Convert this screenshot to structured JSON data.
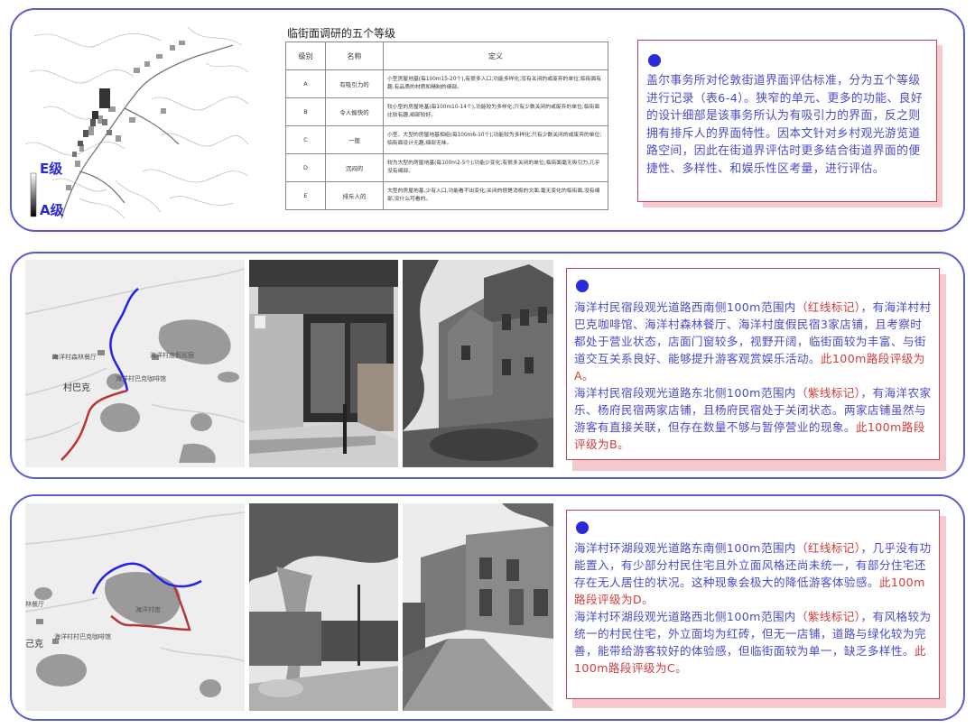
{
  "section1": {
    "map": {
      "legend_top": "E级",
      "legend_bottom": "A级"
    },
    "table": {
      "title": "临街面调研的五个等级",
      "headers": [
        "级别",
        "名称",
        "定义"
      ],
      "rows": [
        {
          "level": "A",
          "name": "有吸引力的",
          "def": "小型房屋地基(每100m15-20个),有很多入口;功能多样化;没有关闭的或废弃的单位;临街面有趣,有品质的材质和精制的细部。"
        },
        {
          "level": "B",
          "name": "令人愉快的",
          "def": "较小型的房屋地基(每100m10-14个),功能较为多样化;只有少数关闭的或废弃的单位;临街面比较有趣,细部较好。"
        },
        {
          "level": "C",
          "name": "一般",
          "def": "小型、大型的房屋地基相组(每100m6-10个);功能较为多样化;只有少数关闭的或废弃的单位;临街面设计无趣,细部无味。"
        },
        {
          "level": "D",
          "name": "沉闷的",
          "def": "较为大型的房屋地基(每100m2-5个);功能少变化;有很多关闭的单位;临街面毫无吸引力,几乎没有细部。"
        },
        {
          "level": "E",
          "name": "排斥人的",
          "def": "大型的房屋地基,少有入口,功能看不出变化;关闭的很是消极的文面,毫无变化的临街面,没有细部,没什么可看的。"
        }
      ]
    },
    "card": {
      "text": "盖尔事务所对伦敦街道界面评估标准，分为五个等级进行记录（表6-4）。狭窄的单元、更多的功能、良好的设计细部是该事务所认为有吸引力的界面，反之则拥有排斥人的界面特性。因本文针对乡村观光游览道路空间，因此在街道界评估时更多结合街道界面的便捷性、多样性、和娱乐性区考量，进行评估。"
    }
  },
  "section2": {
    "map": {
      "label_restaurant": "海洋村森林餐厅",
      "label_cafe": "海洋村巴克咖啡馆",
      "label_hotel": "海洋村度假民宿",
      "label_village": "村巴克"
    },
    "card": {
      "p1_a": "海洋村民宿段观光道路西南侧100m范围内",
      "p1_mark": "（红线标记）",
      "p1_b": "，有海洋村村巴克咖啡馆、海洋村森林餐厅、海洋村度假民宿3家店铺，且考察时都处于营业状态，店面门窗较多，视野开阔，临街面较为丰富、与街道交互关系良好、能够提升游客观赏娱乐活动。",
      "p1_grade": "此100m路段评级为A。",
      "p2_a": "海洋村民宿段观光道路东北侧100m范围内",
      "p2_mark": "（紫线标记）",
      "p2_b": "，有海洋农家乐、杨府民宿两家店铺，且杨府民宿处于关闭状态。两家店铺虽然与游客有直接关联，但存在数量不够与暂停营业的现象。",
      "p2_grade": "此100m路段评级为B。"
    }
  },
  "section3": {
    "map": {
      "label_restaurant": "林餐厅",
      "label_cafe": "海洋村村巴克咖啡馆",
      "label_hotel": "海洋村度",
      "label_village": "己克"
    },
    "card": {
      "p1_a": "海洋村环湖段观光道路东南侧100m范围内",
      "p1_mark": "（红线标记）",
      "p1_b": "，几乎没有功能置入，有少部分村民住宅且外立面风格还尚未统一，有部分住宅还存在无人居住的状况。这种现象会极大的降低游客体验感。",
      "p1_grade": "此100m路段评级为D。",
      "p2_a": "海洋村环湖段观光道路西北侧100m范围内",
      "p2_mark": "（紫线标记）",
      "p2_b": "，有风格较为统一的村民住宅，外立面均为红砖，但无一店铺，道路与绿化较为完善，能带给游客较好的体验感，但临街面较为单一，缺乏多样性。",
      "p2_grade": "此100m路段评级为C。"
    }
  },
  "colors": {
    "frame": "#5b5bd6",
    "card_border": "#b5485e",
    "shadow": "#f6c9cf",
    "red_text": "#d43a3a",
    "blue_text": "#4a4acb"
  }
}
